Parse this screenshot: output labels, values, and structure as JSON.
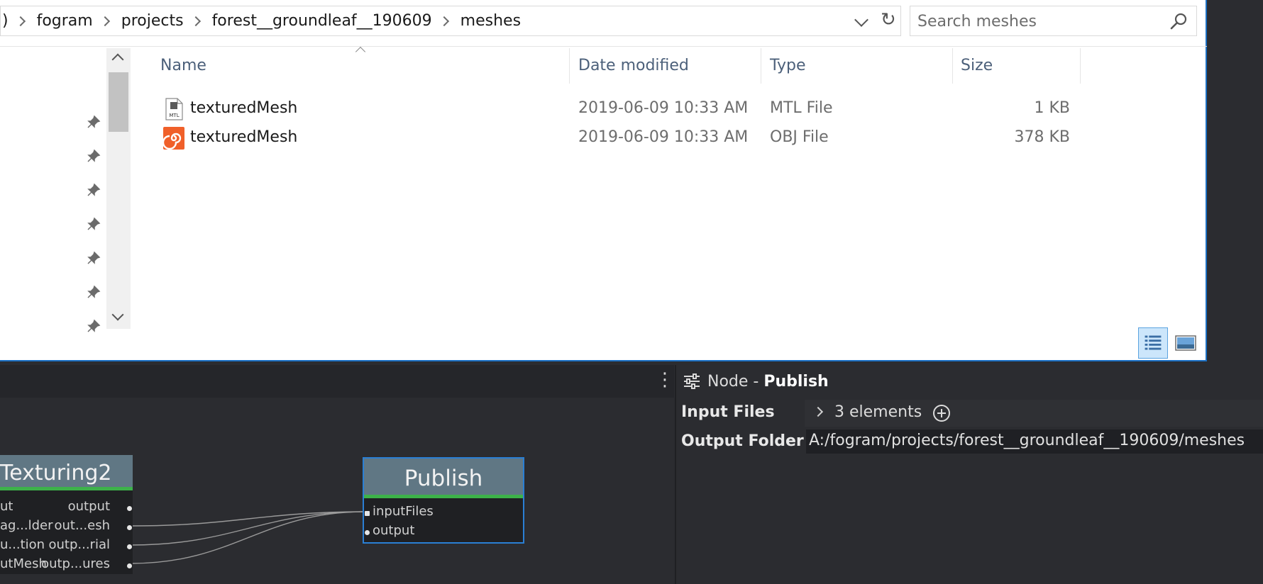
{
  "explorer": {
    "breadcrumbs": [
      ")",
      "fogram",
      "projects",
      "forest__groundleaf__190609",
      "meshes"
    ],
    "search": {
      "placeholder": "Search meshes",
      "value": ""
    },
    "columns": [
      "Name",
      "Date modified",
      "Type",
      "Size"
    ],
    "files": [
      {
        "name": "texturedMesh",
        "date": "2019-06-09 10:33 AM",
        "type": "MTL File",
        "size": "1 KB",
        "icon": "mtl-file-icon"
      },
      {
        "name": "texturedMesh",
        "date": "2019-06-09 10:33 AM",
        "type": "OBJ File",
        "size": "378 KB",
        "icon": "houdini-file-icon"
      }
    ],
    "pinned_count": 7,
    "icons": {
      "refresh": "↻",
      "search": "search-icon",
      "dropdown": "chevron-down-icon"
    },
    "accent": "#1b6fc2"
  },
  "node_panel": {
    "title_prefix": "Node - ",
    "title_node": "Publish",
    "attributes": {
      "input_files_label": "Input Files",
      "input_files_value": "3 elements",
      "output_folder_label": "Output Folder",
      "output_folder_value": "A:/fogram/projects/forest__groundleaf__190609/meshes"
    }
  },
  "graph": {
    "menu_icon": "⋮",
    "nodes": {
      "texturing": {
        "title": "Texturing2",
        "inputs": [
          "ut",
          "ag...lder",
          "u...tion",
          "utMesh"
        ],
        "outputs": [
          "output",
          "out...esh",
          "outp...rial",
          "outp...ures"
        ]
      },
      "publish": {
        "title": "Publish",
        "ports": [
          "inputFiles",
          "output"
        ]
      }
    },
    "colors": {
      "header": "#607784",
      "status": "#3db24a",
      "selected": "#2a7fd4"
    }
  }
}
